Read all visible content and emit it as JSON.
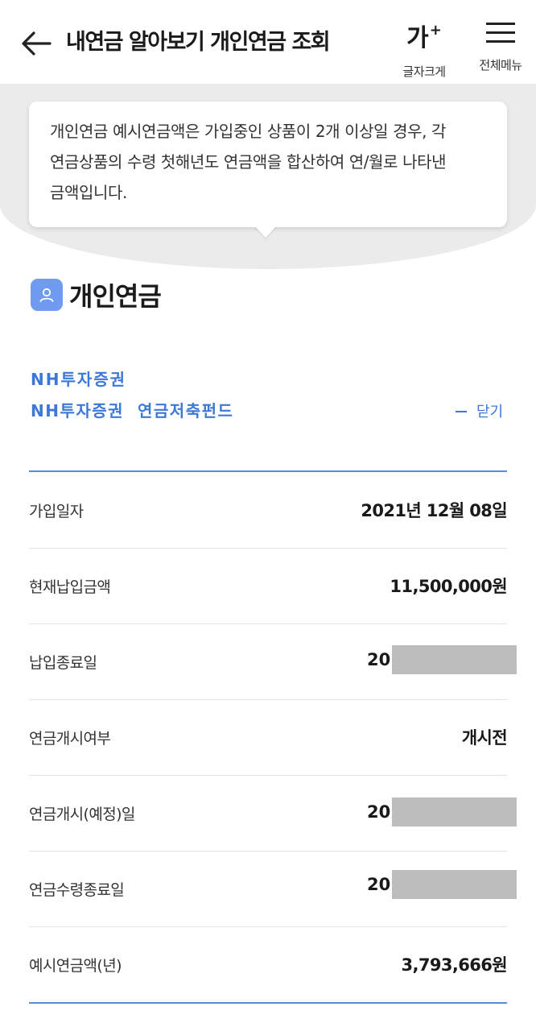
{
  "header": {
    "title": "내연금 알아보기 개인연금 조회",
    "font_size_glyph": "가",
    "font_size_sup": "+",
    "font_size_label": "글자크게",
    "menu_label": "전체메뉴"
  },
  "tooltip": {
    "text": "개인연금 예시연금액은 가입중인 상품이 2개 이상일 경우, 각 연금상품의 수령 첫해년도 연금액을 합산하여 연/월로 나타낸 금액입니다."
  },
  "section": {
    "title": "개인연금"
  },
  "product": {
    "company": "NH투자증권",
    "name": "NH투자증권  연금저축펀드",
    "close_label": "닫기"
  },
  "rows": [
    {
      "label": "가입일자",
      "value": "2021년 12월 08일"
    },
    {
      "label": "현재납입금액",
      "value": "11,500,000원"
    },
    {
      "label": "납입종료일",
      "value": "20"
    },
    {
      "label": "연금개시여부",
      "value": "개시전"
    },
    {
      "label": "연금개시(예정)일",
      "value": "20"
    },
    {
      "label": "연금수령종료일",
      "value": "20"
    },
    {
      "label": "예시연금액(년)",
      "value": "3,793,666원"
    }
  ],
  "colors": {
    "accent": "#3b78d8",
    "badge": "#6f9bf0",
    "mask": "#bdbdbd",
    "backdrop": "#ebebeb"
  },
  "icons": [
    "back-arrow-icon",
    "menu-icon",
    "person-icon"
  ]
}
